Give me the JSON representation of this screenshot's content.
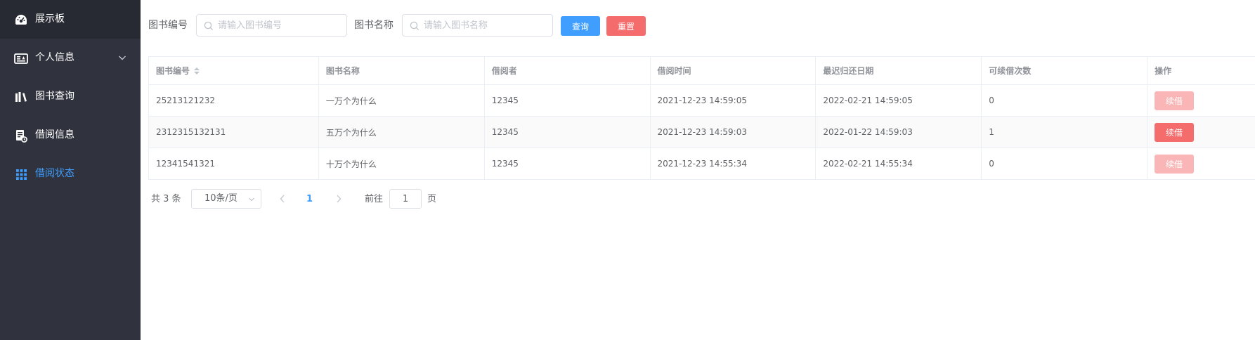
{
  "sidebar": {
    "items": [
      {
        "label": "展示板",
        "icon": "dashboard-icon"
      },
      {
        "label": "个人信息",
        "icon": "id-card-icon"
      },
      {
        "label": "图书查询",
        "icon": "books-icon"
      },
      {
        "label": "借阅信息",
        "icon": "borrow-record-icon"
      },
      {
        "label": "借阅状态",
        "icon": "grid-icon"
      }
    ],
    "active_color": "#409eff",
    "background": "#30333d"
  },
  "search": {
    "book_id_label": "图书编号",
    "book_id_placeholder": "请输入图书编号",
    "book_name_label": "图书名称",
    "book_name_placeholder": "请输入图书名称",
    "query_label": "查询",
    "reset_label": "重置"
  },
  "table": {
    "headers": [
      "图书编号",
      "图书名称",
      "借阅者",
      "借阅时间",
      "最迟归还日期",
      "可续借次数",
      "操作"
    ],
    "rows": [
      {
        "book_id": "25213121232",
        "book_name": "一万个为什么",
        "borrower": "12345",
        "borrow_time": "2021-12-23 14:59:05",
        "due_date": "2022-02-21 14:59:05",
        "renew_count": "0",
        "action": "续借",
        "action_enabled": false
      },
      {
        "book_id": "2312315132131",
        "book_name": "五万个为什么",
        "borrower": "12345",
        "borrow_time": "2021-12-23 14:59:03",
        "due_date": "2022-01-22 14:59:03",
        "renew_count": "1",
        "action": "续借",
        "action_enabled": true
      },
      {
        "book_id": "12341541321",
        "book_name": "十万个为什么",
        "borrower": "12345",
        "borrow_time": "2021-12-23 14:55:34",
        "due_date": "2022-02-21 14:55:34",
        "renew_count": "0",
        "action": "续借",
        "action_enabled": false
      }
    ]
  },
  "pagination": {
    "total": "共 3 条",
    "page_size": "10条/页",
    "current_page": "1",
    "goto_label": "前往",
    "goto_value": "1",
    "page_suffix": "页"
  }
}
